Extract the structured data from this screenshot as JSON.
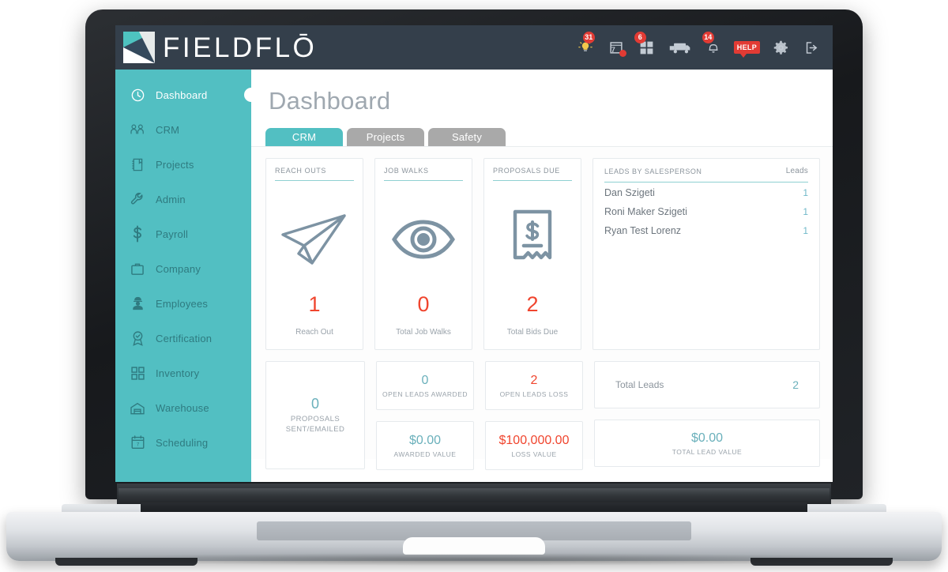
{
  "app": {
    "brand": "FIELDFLŌ",
    "logo_icon": "fieldflo-logo-icon"
  },
  "header": {
    "icons": [
      {
        "name": "lightbulb-icon",
        "glyph": "lightbulb",
        "badge": "31"
      },
      {
        "name": "calendar-icon",
        "glyph": "calendar",
        "day": "7",
        "badge": ""
      },
      {
        "name": "apps-grid-icon",
        "glyph": "grid",
        "badge": "6"
      },
      {
        "name": "truck-icon",
        "glyph": "truck",
        "badge": ""
      },
      {
        "name": "notifications-bell-icon",
        "glyph": "bell",
        "badge": "14"
      },
      {
        "name": "help-icon",
        "glyph": "help",
        "label": "HELP"
      },
      {
        "name": "settings-gear-icon",
        "glyph": "gear",
        "badge": ""
      },
      {
        "name": "logout-icon",
        "glyph": "logout",
        "badge": ""
      }
    ]
  },
  "sidebar": {
    "items": [
      {
        "label": "Dashboard",
        "icon": "clock-icon",
        "active": true
      },
      {
        "label": "CRM",
        "icon": "people-icon",
        "active": false
      },
      {
        "label": "Projects",
        "icon": "notebook-icon",
        "active": false
      },
      {
        "label": "Admin",
        "icon": "wrench-icon",
        "active": false
      },
      {
        "label": "Payroll",
        "icon": "dollar-icon",
        "active": false
      },
      {
        "label": "Company",
        "icon": "briefcase-icon",
        "active": false
      },
      {
        "label": "Employees",
        "icon": "worker-icon",
        "active": false
      },
      {
        "label": "Certification",
        "icon": "award-icon",
        "active": false
      },
      {
        "label": "Inventory",
        "icon": "grid-squares-icon",
        "active": false
      },
      {
        "label": "Warehouse",
        "icon": "warehouse-icon",
        "active": false
      },
      {
        "label": "Scheduling",
        "icon": "calendar-7-icon",
        "active": false
      }
    ]
  },
  "main": {
    "title": "Dashboard",
    "tabs": [
      {
        "label": "CRM",
        "active": true
      },
      {
        "label": "Projects",
        "active": false
      },
      {
        "label": "Safety",
        "active": false
      }
    ],
    "metric_cards": [
      {
        "title": "REACH OUTS",
        "icon": "paper-plane-icon",
        "value": "1",
        "sub": "Reach Out"
      },
      {
        "title": "JOB WALKS",
        "icon": "eye-icon",
        "value": "0",
        "sub": "Total Job Walks"
      },
      {
        "title": "PROPOSALS DUE",
        "icon": "receipt-dollar-icon",
        "value": "2",
        "sub": "Total Bids Due"
      }
    ],
    "leads_panel": {
      "title": "LEADS BY SALESPERSON",
      "count_header": "Leads",
      "rows": [
        {
          "name": "Dan Szigeti",
          "count": "1"
        },
        {
          "name": "Roni Maker Szigeti",
          "count": "1"
        },
        {
          "name": "Ryan Test Lorenz",
          "count": "1"
        }
      ]
    },
    "proposals_card": {
      "value": "0",
      "label_line1": "PROPOSALS",
      "label_line2": "SENT/EMAILED"
    },
    "mini_cards": [
      {
        "value": "0",
        "label": "OPEN LEADS AWARDED",
        "tone": "teal"
      },
      {
        "value": "$0.00",
        "label": "AWARDED VALUE",
        "tone": "teal"
      },
      {
        "value": "2",
        "label": "OPEN LEADS LOSS",
        "tone": "red"
      },
      {
        "value": "$100,000.00",
        "label": "LOSS VALUE",
        "tone": "red"
      }
    ],
    "total_leads": {
      "label": "Total Leads",
      "value": "2"
    },
    "total_lead_value": {
      "value": "$0.00",
      "label": "TOTAL LEAD VALUE"
    }
  },
  "colors": {
    "header_bg": "#343f4b",
    "sidebar_bg": "#52bfc2",
    "accent_teal": "#52bfc2",
    "danger_red": "#f0452e",
    "badge_red": "#e23b34",
    "tab_inactive": "#a9a9a9"
  }
}
